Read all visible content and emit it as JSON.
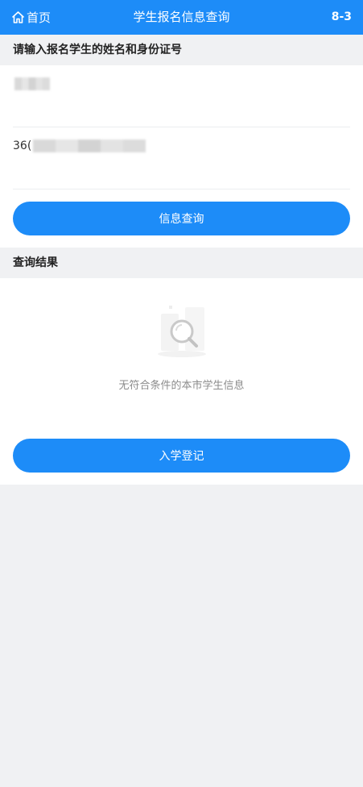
{
  "header": {
    "home_label": "首页",
    "title": "学生报名信息查询",
    "version": "8-3"
  },
  "form": {
    "section_title": "请输入报名学生的姓名和身份证号",
    "name_prefix": "",
    "id_prefix": "36(",
    "submit_label": "信息查询"
  },
  "results": {
    "section_title": "查询结果",
    "empty_text": "无符合条件的本市学生信息",
    "register_label": "入学登记"
  },
  "colors": {
    "primary": "#1d8cf8",
    "background": "#f0f1f3"
  },
  "icons": {
    "home": "home-icon",
    "empty": "search-empty-icon"
  }
}
